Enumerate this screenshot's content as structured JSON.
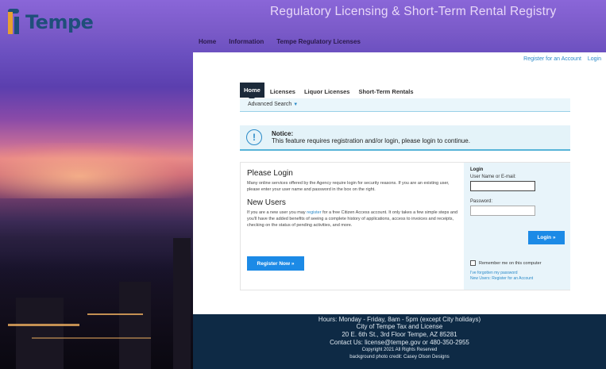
{
  "header": {
    "logo_text": "Tempe",
    "site_title": "Regulatory Licensing & Short-Term Rental Registry",
    "nav": [
      "Home",
      "Information",
      "Tempe Regulatory Licenses"
    ]
  },
  "account": {
    "register_label": "Register for an Account",
    "login_label": "Login"
  },
  "tabs": [
    "Home",
    "Licenses",
    "Liquor Licenses",
    "Short-Term Rentals"
  ],
  "subtabs": {
    "advanced_search": "Advanced Search"
  },
  "notice": {
    "title": "Notice:",
    "message": "This feature requires registration and/or login, please login to continue."
  },
  "please_login": {
    "heading": "Please Login",
    "text": "Many online services offered by the Agency require login for security reasons. If you are an existing user, please enter your user name and password in the box on the right."
  },
  "new_users": {
    "heading": "New Users",
    "text_before": "If you are a new user you may ",
    "link": "register",
    "text_after": " for a free Citizen Access account. It only takes a few simple steps and you'll have the added benefits of seeing a complete history of applications, access to invoices and receipts, checking on the status of pending activities, and more.",
    "register_button": "Register Now »"
  },
  "login_box": {
    "title": "Login",
    "username_label": "User Name or E-mail:",
    "username_value": "",
    "password_label": "Password:",
    "password_value": "",
    "login_button": "Login »",
    "remember_label": "Remember me on this computer",
    "forgot_label": "I've forgotten my password",
    "new_users_link": "New Users: Register for an Account"
  },
  "footer": {
    "hours": "Hours: Monday - Friday, 8am - 5pm (except City holidays)",
    "org": "City of Tempe Tax and License",
    "address": "20 E. 6th St., 3rd Floor Tempe, AZ 85281",
    "contact": "Contact Us: license@tempe.gov or 480-350-2955",
    "copyright": "Copyright 2021 All Rights Reserved",
    "photo_credit": "background photo credit: Casey Olson Designs"
  }
}
